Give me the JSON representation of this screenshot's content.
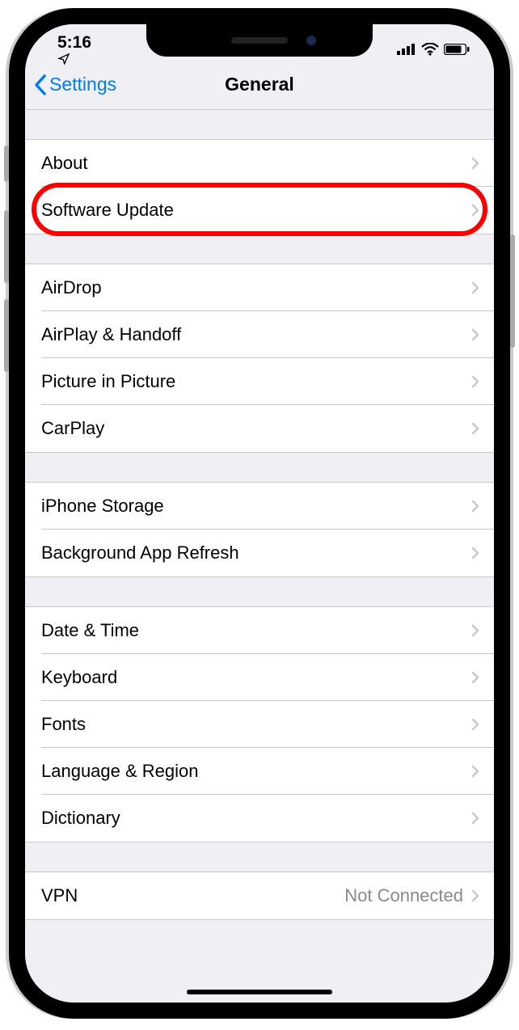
{
  "status": {
    "time": "5:16",
    "location_icon": "location-arrow",
    "signal_bars": 4,
    "wifi": true,
    "battery_pct": 80
  },
  "nav": {
    "back_label": "Settings",
    "title": "General"
  },
  "groups": [
    {
      "rows": [
        {
          "label": "About"
        },
        {
          "label": "Software Update",
          "highlighted": true
        }
      ]
    },
    {
      "rows": [
        {
          "label": "AirDrop"
        },
        {
          "label": "AirPlay & Handoff"
        },
        {
          "label": "Picture in Picture"
        },
        {
          "label": "CarPlay"
        }
      ]
    },
    {
      "rows": [
        {
          "label": "iPhone Storage"
        },
        {
          "label": "Background App Refresh"
        }
      ]
    },
    {
      "rows": [
        {
          "label": "Date & Time"
        },
        {
          "label": "Keyboard"
        },
        {
          "label": "Fonts"
        },
        {
          "label": "Language & Region"
        },
        {
          "label": "Dictionary"
        }
      ]
    },
    {
      "rows": [
        {
          "label": "VPN",
          "detail": "Not Connected"
        }
      ]
    }
  ]
}
